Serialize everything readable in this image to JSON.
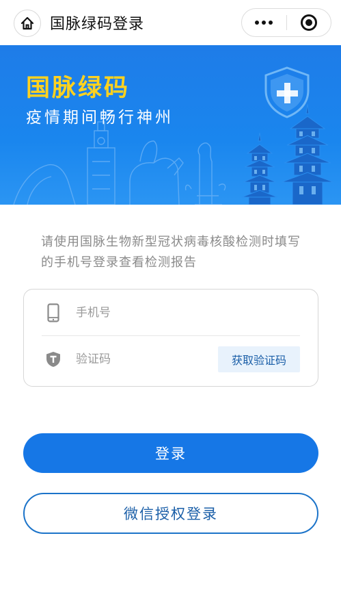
{
  "navbar": {
    "title": "国脉绿码登录",
    "home_icon": "home-icon",
    "more_icon": "more-dots-icon",
    "close_icon": "target-close-icon"
  },
  "banner": {
    "title": "国脉绿码",
    "subtitle": "疫情期间畅行神州",
    "icon": "shield-cross-icon"
  },
  "instruction": {
    "text": "请使用国脉生物新型冠状病毒核酸检测时填写的手机号登录查看检测报告"
  },
  "form": {
    "phone_placeholder": "手机号",
    "phone_value": "",
    "code_placeholder": "验证码",
    "code_value": "",
    "get_code_label": "获取验证码"
  },
  "actions": {
    "login_label": "登录",
    "wechat_login_label": "微信授权登录"
  },
  "colors": {
    "primary": "#1677e6",
    "banner_title": "#ffd21f",
    "outline": "#1b73c9"
  }
}
